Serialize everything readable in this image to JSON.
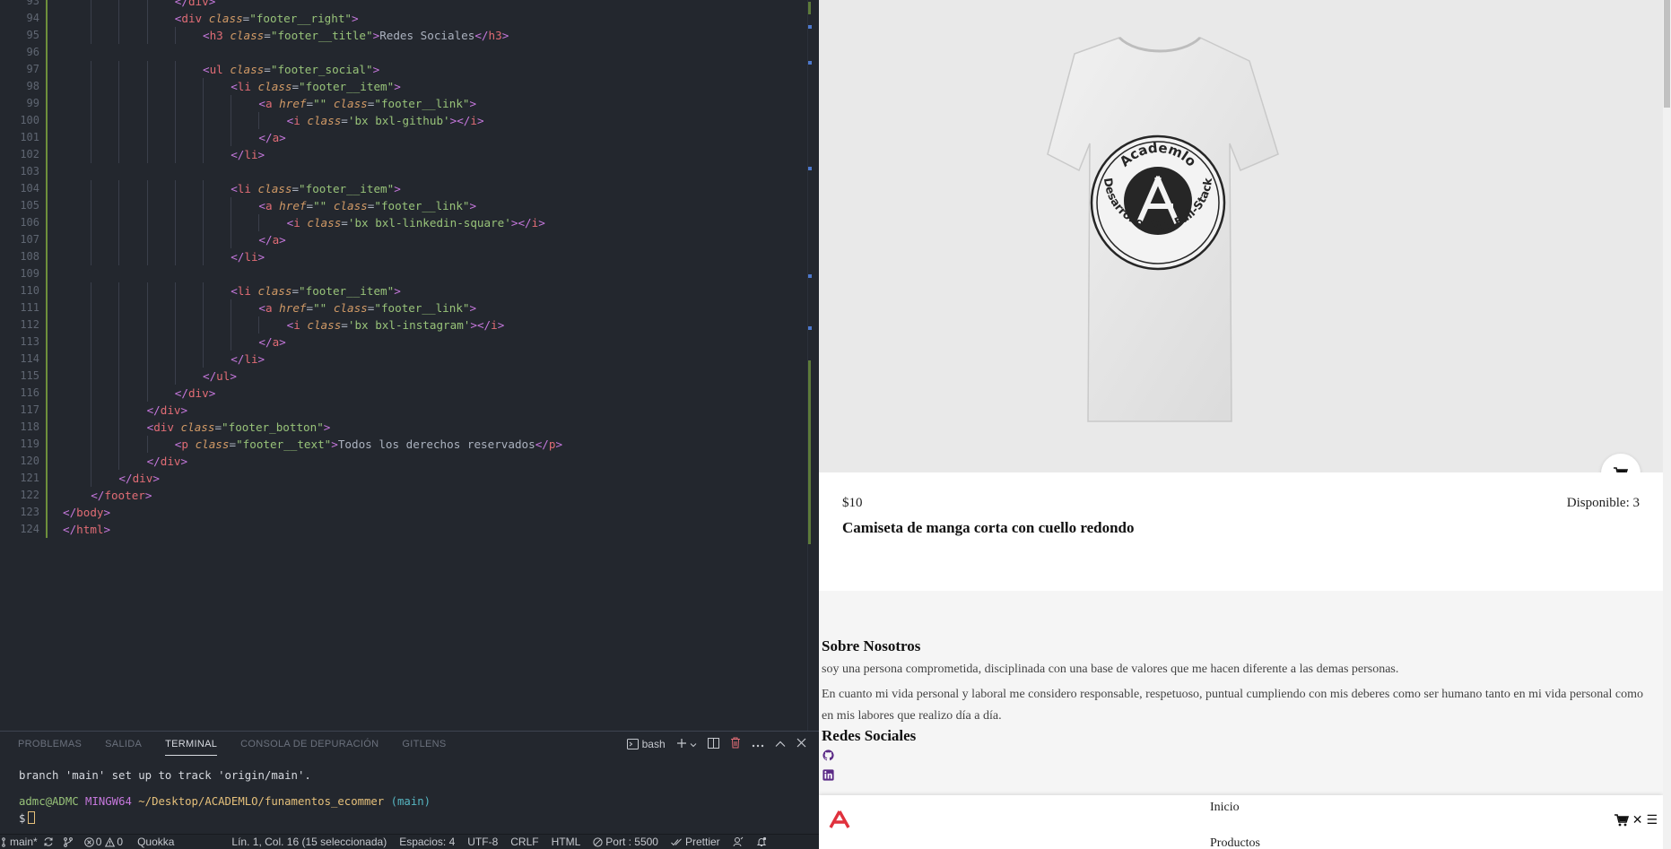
{
  "editor": {
    "lines": [
      {
        "n": "93",
        "indent": 4,
        "parts": [
          [
            "br",
            "</"
          ],
          [
            "tg",
            "div"
          ],
          [
            "br",
            ">"
          ]
        ]
      },
      {
        "n": "94",
        "indent": 4,
        "parts": [
          [
            "br",
            "<"
          ],
          [
            "tg",
            "div "
          ],
          [
            "at",
            "class"
          ],
          [
            "pl",
            "="
          ],
          [
            "st",
            "\"footer__right\""
          ],
          [
            "br",
            ">"
          ]
        ]
      },
      {
        "n": "95",
        "indent": 5,
        "parts": [
          [
            "br",
            "<"
          ],
          [
            "tg",
            "h3 "
          ],
          [
            "at",
            "class"
          ],
          [
            "pl",
            "="
          ],
          [
            "st",
            "\"footer__title\""
          ],
          [
            "br",
            ">"
          ],
          [
            "pl",
            "Redes Sociales"
          ],
          [
            "br",
            "</"
          ],
          [
            "tg",
            "h3"
          ],
          [
            "br",
            ">"
          ]
        ]
      },
      {
        "n": "96",
        "indent": 0,
        "parts": []
      },
      {
        "n": "97",
        "indent": 5,
        "parts": [
          [
            "br",
            "<"
          ],
          [
            "tg",
            "ul "
          ],
          [
            "at",
            "class"
          ],
          [
            "pl",
            "="
          ],
          [
            "st",
            "\"footer_social\""
          ],
          [
            "br",
            ">"
          ]
        ]
      },
      {
        "n": "98",
        "indent": 6,
        "parts": [
          [
            "br",
            "<"
          ],
          [
            "tg",
            "li "
          ],
          [
            "at",
            "class"
          ],
          [
            "pl",
            "="
          ],
          [
            "st",
            "\"footer__item\""
          ],
          [
            "br",
            ">"
          ]
        ]
      },
      {
        "n": "99",
        "indent": 7,
        "parts": [
          [
            "br",
            "<"
          ],
          [
            "tg",
            "a "
          ],
          [
            "at",
            "href"
          ],
          [
            "pl",
            "="
          ],
          [
            "st",
            "\"\" "
          ],
          [
            "at",
            "class"
          ],
          [
            "pl",
            "="
          ],
          [
            "st",
            "\"footer__link\""
          ],
          [
            "br",
            ">"
          ]
        ]
      },
      {
        "n": "100",
        "indent": 8,
        "parts": [
          [
            "br",
            "<"
          ],
          [
            "tg",
            "i "
          ],
          [
            "at",
            "class"
          ],
          [
            "pl",
            "="
          ],
          [
            "st",
            "'bx bxl-github'"
          ],
          [
            "br",
            "></"
          ],
          [
            "tg",
            "i"
          ],
          [
            "br",
            ">"
          ]
        ]
      },
      {
        "n": "101",
        "indent": 7,
        "parts": [
          [
            "br",
            "</"
          ],
          [
            "tg",
            "a"
          ],
          [
            "br",
            ">"
          ]
        ]
      },
      {
        "n": "102",
        "indent": 6,
        "parts": [
          [
            "br",
            "</"
          ],
          [
            "tg",
            "li"
          ],
          [
            "br",
            ">"
          ]
        ]
      },
      {
        "n": "103",
        "indent": 0,
        "parts": []
      },
      {
        "n": "104",
        "indent": 6,
        "parts": [
          [
            "br",
            "<"
          ],
          [
            "tg",
            "li "
          ],
          [
            "at",
            "class"
          ],
          [
            "pl",
            "="
          ],
          [
            "st",
            "\"footer__item\""
          ],
          [
            "br",
            ">"
          ]
        ]
      },
      {
        "n": "105",
        "indent": 7,
        "parts": [
          [
            "br",
            "<"
          ],
          [
            "tg",
            "a "
          ],
          [
            "at",
            "href"
          ],
          [
            "pl",
            "="
          ],
          [
            "st",
            "\"\" "
          ],
          [
            "at",
            "class"
          ],
          [
            "pl",
            "="
          ],
          [
            "st",
            "\"footer__link\""
          ],
          [
            "br",
            ">"
          ]
        ]
      },
      {
        "n": "106",
        "indent": 8,
        "parts": [
          [
            "br",
            "<"
          ],
          [
            "tg",
            "i "
          ],
          [
            "at",
            "class"
          ],
          [
            "pl",
            "="
          ],
          [
            "st",
            "'bx bxl-linkedin-square'"
          ],
          [
            "br",
            "></"
          ],
          [
            "tg",
            "i"
          ],
          [
            "br",
            ">"
          ]
        ]
      },
      {
        "n": "107",
        "indent": 7,
        "parts": [
          [
            "br",
            "</"
          ],
          [
            "tg",
            "a"
          ],
          [
            "br",
            ">"
          ]
        ]
      },
      {
        "n": "108",
        "indent": 6,
        "parts": [
          [
            "br",
            "</"
          ],
          [
            "tg",
            "li"
          ],
          [
            "br",
            ">"
          ]
        ]
      },
      {
        "n": "109",
        "indent": 0,
        "parts": []
      },
      {
        "n": "110",
        "indent": 6,
        "parts": [
          [
            "br",
            "<"
          ],
          [
            "tg",
            "li "
          ],
          [
            "at",
            "class"
          ],
          [
            "pl",
            "="
          ],
          [
            "st",
            "\"footer__item\""
          ],
          [
            "br",
            ">"
          ]
        ]
      },
      {
        "n": "111",
        "indent": 7,
        "parts": [
          [
            "br",
            "<"
          ],
          [
            "tg",
            "a "
          ],
          [
            "at",
            "href"
          ],
          [
            "pl",
            "="
          ],
          [
            "st",
            "\"\" "
          ],
          [
            "at",
            "class"
          ],
          [
            "pl",
            "="
          ],
          [
            "st",
            "\"footer__link\""
          ],
          [
            "br",
            ">"
          ]
        ]
      },
      {
        "n": "112",
        "indent": 8,
        "parts": [
          [
            "br",
            "<"
          ],
          [
            "tg",
            "i "
          ],
          [
            "at",
            "class"
          ],
          [
            "pl",
            "="
          ],
          [
            "st",
            "'bx bxl-instagram'"
          ],
          [
            "br",
            "></"
          ],
          [
            "tg",
            "i"
          ],
          [
            "br",
            ">"
          ]
        ]
      },
      {
        "n": "113",
        "indent": 7,
        "parts": [
          [
            "br",
            "</"
          ],
          [
            "tg",
            "a"
          ],
          [
            "br",
            ">"
          ]
        ]
      },
      {
        "n": "114",
        "indent": 6,
        "parts": [
          [
            "br",
            "</"
          ],
          [
            "tg",
            "li"
          ],
          [
            "br",
            ">"
          ]
        ]
      },
      {
        "n": "115",
        "indent": 5,
        "parts": [
          [
            "br",
            "</"
          ],
          [
            "tg",
            "ul"
          ],
          [
            "br",
            ">"
          ]
        ]
      },
      {
        "n": "116",
        "indent": 4,
        "parts": [
          [
            "br",
            "</"
          ],
          [
            "tg",
            "div"
          ],
          [
            "br",
            ">"
          ]
        ]
      },
      {
        "n": "117",
        "indent": 3,
        "parts": [
          [
            "br",
            "</"
          ],
          [
            "tg",
            "div"
          ],
          [
            "br",
            ">"
          ]
        ]
      },
      {
        "n": "118",
        "indent": 3,
        "parts": [
          [
            "br",
            "<"
          ],
          [
            "tg",
            "div "
          ],
          [
            "at",
            "class"
          ],
          [
            "pl",
            "="
          ],
          [
            "st",
            "\"footer_botton\""
          ],
          [
            "br",
            ">"
          ]
        ]
      },
      {
        "n": "119",
        "indent": 4,
        "parts": [
          [
            "br",
            "<"
          ],
          [
            "tg",
            "p "
          ],
          [
            "at",
            "class"
          ],
          [
            "pl",
            "="
          ],
          [
            "st",
            "\"footer__text\""
          ],
          [
            "br",
            ">"
          ],
          [
            "pl",
            "Todos los derechos reservados"
          ],
          [
            "br",
            "</"
          ],
          [
            "tg",
            "p"
          ],
          [
            "br",
            ">"
          ]
        ]
      },
      {
        "n": "120",
        "indent": 3,
        "parts": [
          [
            "br",
            "</"
          ],
          [
            "tg",
            "div"
          ],
          [
            "br",
            ">"
          ]
        ]
      },
      {
        "n": "121",
        "indent": 2,
        "parts": [
          [
            "br",
            "</"
          ],
          [
            "tg",
            "div"
          ],
          [
            "br",
            ">"
          ]
        ]
      },
      {
        "n": "122",
        "indent": 1,
        "parts": [
          [
            "br",
            "</"
          ],
          [
            "tg",
            "footer"
          ],
          [
            "br",
            ">"
          ]
        ]
      },
      {
        "n": "123",
        "indent": 0,
        "parts": [
          [
            "br",
            "</"
          ],
          [
            "tg",
            "body"
          ],
          [
            "br",
            ">"
          ]
        ]
      },
      {
        "n": "124",
        "indent": 0,
        "parts": [
          [
            "br",
            "</"
          ],
          [
            "tg",
            "html"
          ],
          [
            "br",
            ">"
          ]
        ]
      }
    ]
  },
  "panel": {
    "tabs": [
      "PROBLEMAS",
      "SALIDA",
      "TERMINAL",
      "CONSOLA DE DEPURACIÓN",
      "GITLENS"
    ],
    "active_tab": "TERMINAL",
    "shell_label": "bash",
    "terminal": {
      "line1": "branch 'main' set up to track 'origin/main'.",
      "user": "admc@ADMC",
      "host": "MINGW64",
      "path": "~/Desktop/ACADEMLO/funamentos_ecommer",
      "branch": "(main)",
      "prompt": "$"
    }
  },
  "statusbar": {
    "branch": "main*",
    "problems": "0",
    "warnings": "0",
    "quokka": "Quokka",
    "position": "Lín. 1, Col. 16 (15 seleccionada)",
    "spaces": "Espacios: 4",
    "encoding": "UTF-8",
    "eol": "CRLF",
    "language": "HTML",
    "port": "Port : 5500",
    "prettier": "Prettier"
  },
  "browser": {
    "shirt_text_top": "Academlo",
    "shirt_text_bottom": "Desarrollo Web Full-Stack",
    "price": "$10",
    "stock": "Disponible: 3",
    "product_name": "Camiseta de manga corta con cuello redondo",
    "about_title": "Sobre Nosotros",
    "about_p1": "soy una persona comprometida, disciplinada con una base de valores que me hacen diferente a las demas personas.",
    "about_p2": "En cuanto mi vida personal y laboral me considero responsable, respetuoso, puntual cumpliendo con mis deberes como ser humano tanto en mi vida personal como en mis labores que realizo día a día.",
    "social_title": "Redes Sociales",
    "nav_home": "Inicio",
    "nav_products": "Productos",
    "nav_close": "✕",
    "nav_menu": "☰"
  },
  "colors": {
    "accent_brand": "#e0313d",
    "social_icon": "#5b2a86"
  },
  "icons": [
    "git-branch-icon",
    "sync-icon",
    "error-icon",
    "warning-icon",
    "cart-icon",
    "github-icon",
    "linkedin-icon",
    "close-icon",
    "menu-icon",
    "academlo-logo"
  ]
}
